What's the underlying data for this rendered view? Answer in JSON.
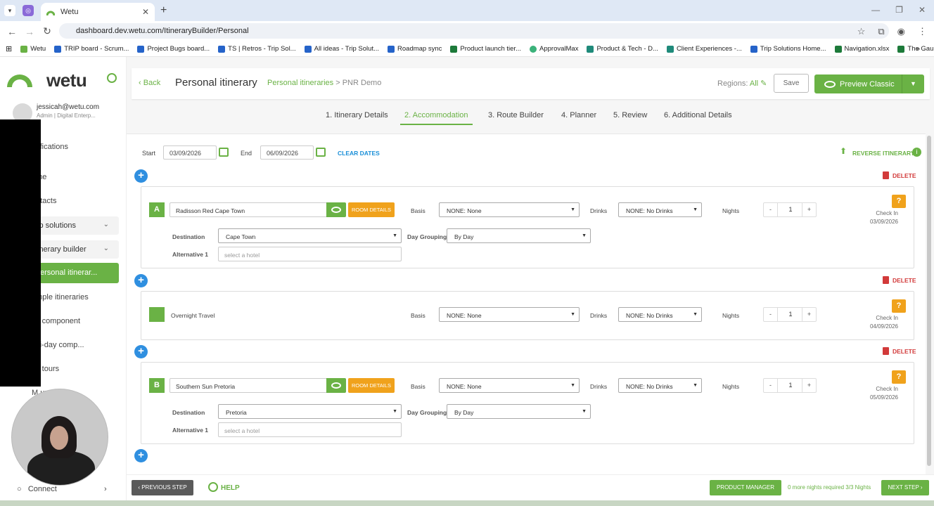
{
  "browser": {
    "tab_title": "Wetu",
    "url": "dashboard.dev.wetu.com/ItineraryBuilder/Personal",
    "bookmarks": [
      "Wetu",
      "TRIP board - Scrum...",
      "Project Bugs board...",
      "TS | Retros - Trip Sol...",
      "All ideas - Trip Solut...",
      "Roadmap sync",
      "Product launch tier...",
      "ApprovalMax",
      "Product & Tech - D...",
      "Client Experiences -...",
      "Trip Solutions Home...",
      "Navigation.xlsx",
      "The Gauntlet.xlsx"
    ]
  },
  "sidebar": {
    "logo": "wetu",
    "user_email": "jessicah@wetu.com",
    "user_role": "Admin | Digital Enterp...",
    "items": {
      "notifications": "otifications",
      "home": "ome",
      "contacts": "ontacts",
      "trip_solutions": "ip solutions",
      "itinerary_builder": "inerary builder",
      "personal": "ersonal itinerar...",
      "sample": "ample itineraries",
      "day_component": "ay component",
      "multi_day": "ulti-day comp...",
      "day_tours": "ay tours",
      "more": "M        urs"
    },
    "connect": "Connect"
  },
  "header": {
    "back": "Back",
    "title": "Personal itinerary",
    "breadcrumb_link": "Personal itineraries",
    "breadcrumb_sep": ">",
    "breadcrumb_current": "PNR Demo",
    "regions_label": "Regions:",
    "regions_value": "All",
    "save": "Save",
    "preview": "Preview Classic"
  },
  "steps": [
    "1. Itinerary Details",
    "2. Accommodation",
    "3. Route Builder",
    "4. Planner",
    "5. Review",
    "6. Additional Details"
  ],
  "dates": {
    "start_label": "Start",
    "start": "03/09/2026",
    "end_label": "End",
    "end": "06/09/2026",
    "clear": "CLEAR DATES",
    "reverse": "REVERSE ITINERARY"
  },
  "labels": {
    "delete": "DELETE",
    "room_details": "ROOM DETAILS",
    "basis": "Basis",
    "drinks": "Drinks",
    "nights": "Nights",
    "destination": "Destination",
    "day_grouping": "Day Grouping",
    "alternative": "Alternative 1",
    "alt_placeholder": "select a hotel",
    "check_in": "Check In"
  },
  "cards": [
    {
      "badge": "A",
      "hotel": "Radisson Red Cape Town",
      "basis": "NONE: None",
      "drinks": "NONE: No Drinks",
      "nights": "1",
      "destination": "Cape Town",
      "grouping": "By Day",
      "check_in": "03/09/2026"
    },
    {
      "badge": "",
      "hotel": "Overnight Travel",
      "basis": "NONE: None",
      "drinks": "NONE: No Drinks",
      "nights": "1",
      "check_in": "04/09/2026"
    },
    {
      "badge": "B",
      "hotel": "Southern Sun Pretoria",
      "basis": "NONE: None",
      "drinks": "NONE: No Drinks",
      "nights": "1",
      "destination": "Pretoria",
      "grouping": "By Day",
      "check_in": "05/09/2026"
    }
  ],
  "footer": {
    "prev": "PREVIOUS STEP",
    "help": "HELP",
    "product_manager": "PRODUCT MANAGER",
    "nights_required": "0 more nights required 3/3 Nights",
    "next": "NEXT STEP"
  },
  "colors": {
    "brand_green": "#6ab245",
    "orange": "#f0a21c",
    "blue": "#2f8fe0",
    "red": "#d23a3a"
  }
}
